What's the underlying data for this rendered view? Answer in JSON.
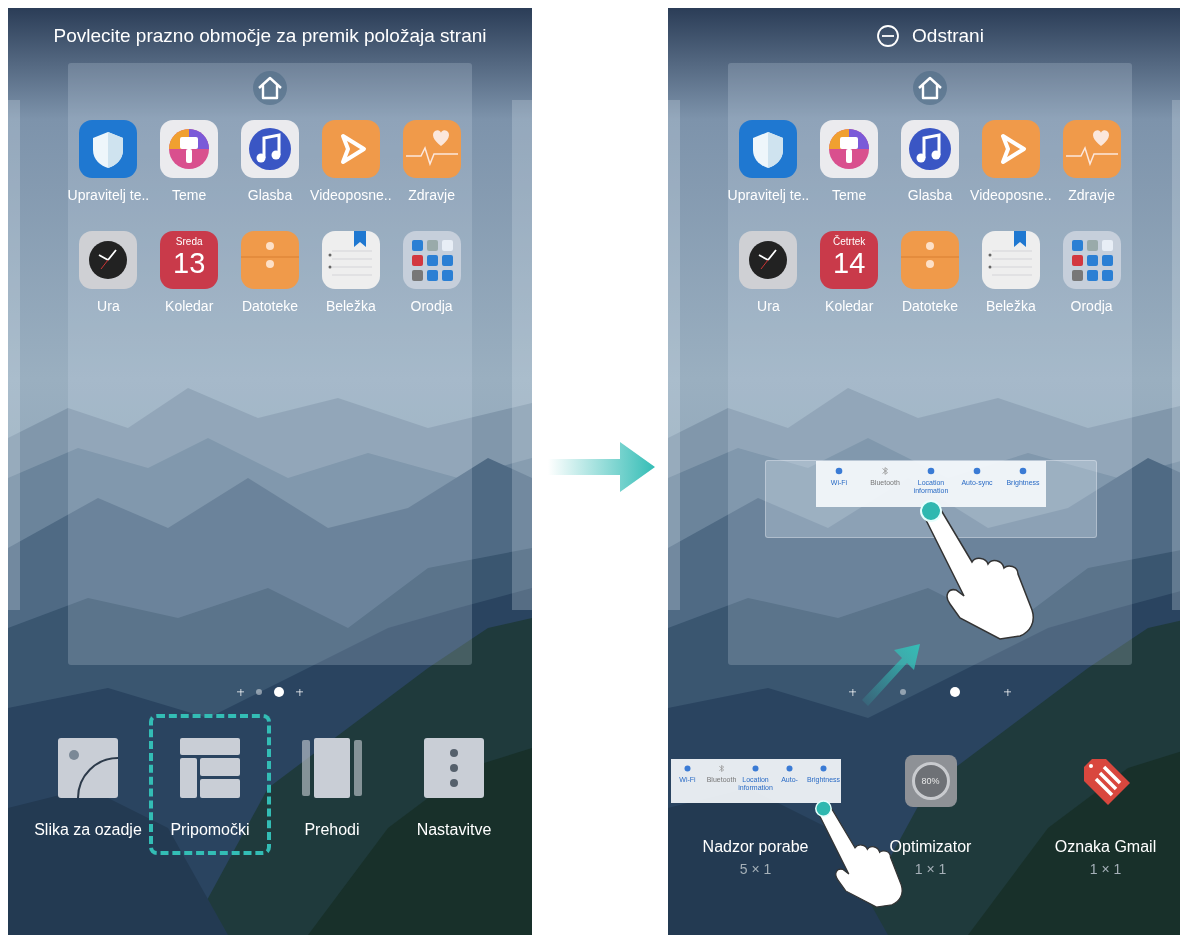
{
  "screens": [
    {
      "hint": "Povlecite prazno območje za premik položaja strani",
      "apps": [
        {
          "kind": "shield",
          "label": "Upravitelj te.."
        },
        {
          "kind": "themes",
          "label": "Teme"
        },
        {
          "kind": "music",
          "label": "Glasba"
        },
        {
          "kind": "video",
          "label": "Videoposne.."
        },
        {
          "kind": "health",
          "label": "Zdravje"
        },
        {
          "kind": "clock",
          "label": "Ura"
        },
        {
          "kind": "calendar",
          "label": "Koledar",
          "day": "Sreda",
          "date": "13"
        },
        {
          "kind": "files",
          "label": "Datoteke"
        },
        {
          "kind": "notes",
          "label": "Beležka"
        },
        {
          "kind": "folder",
          "label": "Orodja"
        }
      ],
      "page_dots": [
        {
          "kind": "add",
          "selected": false
        },
        {
          "kind": "page",
          "selected": false
        },
        {
          "kind": "page",
          "selected": true
        },
        {
          "kind": "add",
          "selected": false
        }
      ],
      "options": [
        {
          "kind": "wallpaper",
          "label": "Slika za ozadje",
          "selected": false
        },
        {
          "kind": "widgets",
          "label": "Pripomočki",
          "selected": true
        },
        {
          "kind": "transitions",
          "label": "Prehodi",
          "selected": false
        },
        {
          "kind": "settings",
          "label": "Nastavitve",
          "selected": false
        }
      ]
    },
    {
      "remove_button": "Odstrani",
      "apps": [
        {
          "kind": "shield",
          "label": "Upravitelj te.."
        },
        {
          "kind": "themes",
          "label": "Teme"
        },
        {
          "kind": "music",
          "label": "Glasba"
        },
        {
          "kind": "video",
          "label": "Videoposne.."
        },
        {
          "kind": "health",
          "label": "Zdravje"
        },
        {
          "kind": "clock",
          "label": "Ura"
        },
        {
          "kind": "calendar",
          "label": "Koledar",
          "day": "Četrtek",
          "date": "14"
        },
        {
          "kind": "files",
          "label": "Datoteke"
        },
        {
          "kind": "notes",
          "label": "Beležka"
        },
        {
          "kind": "folder",
          "label": "Orodja"
        }
      ],
      "dragged_widget": {
        "toggles": [
          {
            "kind": "wifi",
            "label": "Wi-Fi",
            "on": true
          },
          {
            "kind": "bluetooth",
            "label": "Bluetooth",
            "on": false
          },
          {
            "kind": "location",
            "label": "Location information",
            "on": true
          },
          {
            "kind": "sync",
            "label": "Auto-sync",
            "on": true
          },
          {
            "kind": "brightness",
            "label": "Brightness",
            "on": true
          }
        ]
      },
      "page_dots": [
        {
          "kind": "add",
          "selected": false
        },
        {
          "kind": "page",
          "selected": false
        },
        {
          "kind": "page",
          "selected": true
        },
        {
          "kind": "add",
          "selected": false
        }
      ],
      "widgets": [
        {
          "kind": "switches",
          "name": "Nadzor porabe",
          "size": "5 × 1",
          "toggles": [
            {
              "kind": "wifi",
              "label": "Wi-Fi",
              "on": true
            },
            {
              "kind": "bluetooth",
              "label": "Bluetooth",
              "on": false
            },
            {
              "kind": "location",
              "label": "Location information",
              "on": true
            },
            {
              "kind": "sync",
              "label": "Auto-",
              "on": true
            },
            {
              "kind": "brightness",
              "label": "Brightness",
              "on": true
            }
          ]
        },
        {
          "kind": "optimizer",
          "name": "Optimizator",
          "size": "1 × 1",
          "reading": "80%"
        },
        {
          "kind": "tag",
          "name": "Oznaka Gmail",
          "size": "1 × 1"
        }
      ]
    }
  ]
}
